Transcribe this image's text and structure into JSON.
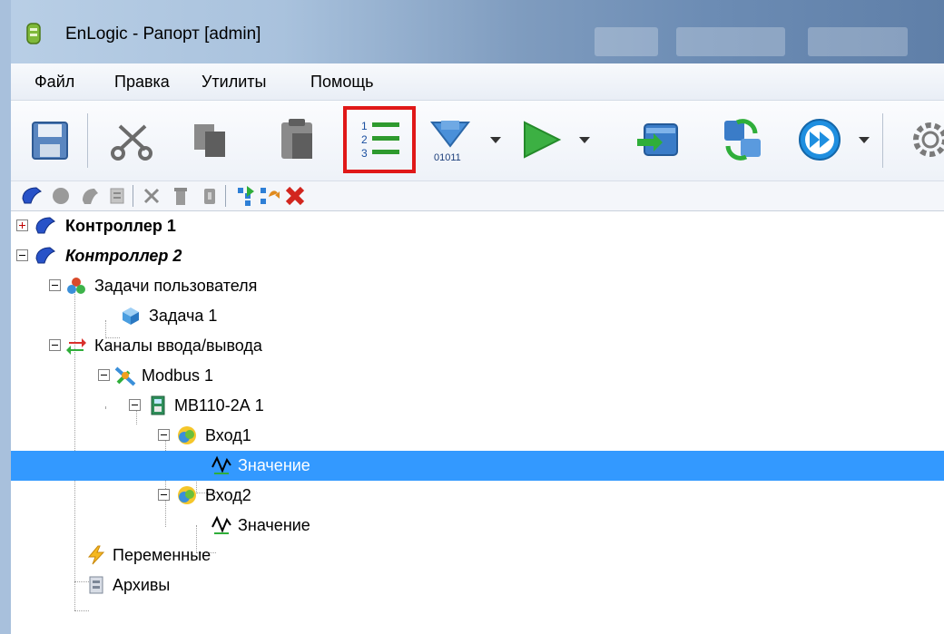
{
  "window": {
    "title": "EnLogic - Рапорт [admin]"
  },
  "menu": {
    "items": [
      "Файл",
      "Правка",
      "Утилиты",
      "Помощь"
    ]
  },
  "toolbar": {
    "icons": [
      "save-icon",
      "cut-icon",
      "copy-icon",
      "paste-icon",
      "numbered-list-icon",
      "download-binary-icon",
      "run-icon",
      "database-icon",
      "sync-icon",
      "fast-forward-icon",
      "gear-icon"
    ],
    "highlighted": "numbered-list-icon",
    "highlight_color": "#e01818"
  },
  "toolbar2": {
    "icons": [
      "add-controller-icon",
      "add-node-icon",
      "add-shape-icon",
      "add-channel-icon",
      "cut-node-icon",
      "delete-node-icon",
      "bin-icon",
      "tree-expand-icon",
      "tree-undo-icon",
      "delete-x-icon"
    ]
  },
  "tree": {
    "nodes": [
      {
        "label": "Контроллер 1",
        "icon": "controller-icon"
      },
      {
        "label": "Контроллер 2",
        "icon": "controller-icon"
      },
      {
        "label": "Задачи пользователя",
        "icon": "tasks-icon"
      },
      {
        "label": "Задача 1",
        "icon": "cube-icon"
      },
      {
        "label": "Каналы ввода/вывода",
        "icon": "io-channels-icon"
      },
      {
        "label": "Modbus 1",
        "icon": "modbus-icon"
      },
      {
        "label": "МВ110-2А 1",
        "icon": "device-icon"
      },
      {
        "label": "Вход1",
        "icon": "input-icon"
      },
      {
        "label": "Значение",
        "icon": "signal-icon"
      },
      {
        "label": "Вход2",
        "icon": "input-icon"
      },
      {
        "label": "Значение",
        "icon": "signal-icon"
      },
      {
        "label": "Переменные",
        "icon": "lightning-icon"
      },
      {
        "label": "Архивы",
        "icon": "archive-icon"
      }
    ],
    "selected_color": "#3399ff"
  }
}
